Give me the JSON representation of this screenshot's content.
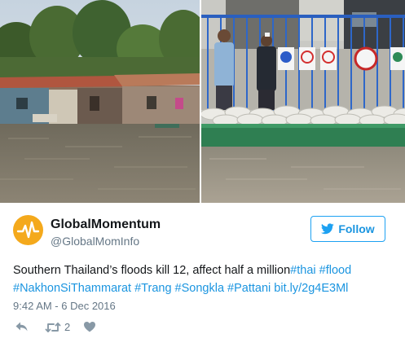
{
  "author": {
    "display_name": "GlobalMomentum",
    "handle": "@GlobalMomInfo",
    "avatar_icon": "pulse-icon",
    "avatar_color": "#f4a91c"
  },
  "follow_button": {
    "label": "Follow",
    "icon": "twitter-bird-icon",
    "color": "#1da1f2"
  },
  "tweet": {
    "text": "Southern Thailand’s floods kill 12, affect half a million",
    "links": [
      "#thai",
      "#flood",
      "#NakhonSiThammarat",
      "#Trang",
      "#Songkla",
      "#Pattani",
      "bit.ly/2g4E3Ml"
    ],
    "link_color": "#1b95e0",
    "timestamp": "9:42 AM - 6 Dec 2016"
  },
  "actions": {
    "reply_icon": "reply-icon",
    "retweet_icon": "retweet-icon",
    "retweet_count": "2",
    "like_icon": "heart-icon"
  },
  "media": [
    {
      "icon": "flooded-village-photo"
    },
    {
      "icon": "flood-sandbags-photo"
    }
  ]
}
